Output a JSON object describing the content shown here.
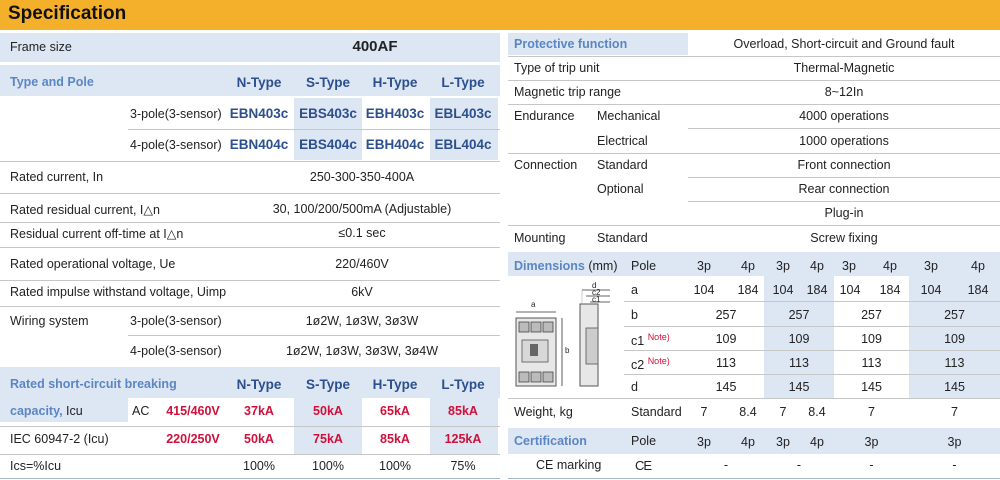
{
  "title": "Specification",
  "left": {
    "frame_size": {
      "label": "Frame size",
      "value": "400AF"
    },
    "type_pole": {
      "label": "Type and Pole",
      "types": [
        "N-Type",
        "S-Type",
        "H-Type",
        "L-Type"
      ],
      "rows": [
        {
          "pole": "3-pole(3-sensor)",
          "models": [
            "EBN403c",
            "EBS403c",
            "EBH403c",
            "EBL403c"
          ]
        },
        {
          "pole": "4-pole(3-sensor)",
          "models": [
            "EBN404c",
            "EBS404c",
            "EBH404c",
            "EBL404c"
          ]
        }
      ]
    },
    "rated_current": {
      "label": "Rated current, In",
      "value": "250-300-350-400A"
    },
    "residual_current": {
      "label": "Rated residual current, I△n",
      "value": "30, 100/200/500mA (Adjustable)"
    },
    "residual_offtime": {
      "label": "Residual current off-time at I△n",
      "value": "≤0.1 sec"
    },
    "operational_voltage": {
      "label": "Rated operational voltage, Ue",
      "value": "220/460V"
    },
    "impulse_voltage": {
      "label": "Rated impulse withstand voltage, Uimp",
      "value": "6kV"
    },
    "wiring": {
      "label": "Wiring system",
      "rows": [
        {
          "pole": "3-pole(3-sensor)",
          "value": "1ø2W, 1ø3W, 3ø3W"
        },
        {
          "pole": "4-pole(3-sensor)",
          "value": "1ø2W, 1ø3W, 3ø3W, 3ø4W"
        }
      ]
    },
    "breaking": {
      "label1": "Rated short-circuit breaking",
      "label2a": "capacity,",
      "label2b": " Icu",
      "types": [
        "N-Type",
        "S-Type",
        "H-Type",
        "L-Type"
      ],
      "ac_label": "AC",
      "rows": [
        {
          "label": "",
          "voltage": "415/460V",
          "values": [
            "37kA",
            "50kA",
            "65kA",
            "85kA"
          ]
        },
        {
          "label": "IEC 60947-2 (Icu)",
          "voltage": "220/250V",
          "values": [
            "50kA",
            "75kA",
            "85kA",
            "125kA"
          ]
        },
        {
          "label": "Ics=%Icu",
          "voltage": "",
          "values": [
            "100%",
            "100%",
            "100%",
            "75%"
          ]
        }
      ]
    }
  },
  "right": {
    "protective": {
      "label": "Protective function",
      "value": "Overload, Short-circuit and Ground fault"
    },
    "trip_unit": {
      "label": "Type of trip unit",
      "value": "Thermal-Magnetic"
    },
    "trip_range": {
      "label": "Magnetic trip range",
      "value": "8~12In"
    },
    "endurance": {
      "label": "Endurance",
      "rows": [
        {
          "sub": "Mechanical",
          "value": "4000 operations"
        },
        {
          "sub": "Electrical",
          "value": "1000 operations"
        }
      ]
    },
    "connection": {
      "label": "Connection",
      "rows": [
        {
          "sub": "Standard",
          "value": "Front connection"
        },
        {
          "sub": "Optional",
          "value": "Rear connection"
        },
        {
          "sub": "",
          "value": "Plug-in"
        }
      ]
    },
    "mounting": {
      "label": "Mounting",
      "sub": "Standard",
      "value": "Screw fixing"
    },
    "dimensions": {
      "label": "Dimensions",
      "unit": " (mm)",
      "pole_label": "Pole",
      "poles": [
        "3p",
        "4p",
        "3p",
        "4p",
        "3p",
        "4p",
        "3p",
        "4p"
      ],
      "rows": [
        {
          "key": "a",
          "note": "",
          "values": [
            "104",
            "184",
            "104",
            "184",
            "104",
            "184",
            "104",
            "184"
          ]
        },
        {
          "key": "b",
          "note": "",
          "values": [
            "257",
            "257",
            "257",
            "257"
          ]
        },
        {
          "key": "c1",
          "note": "Note)",
          "values": [
            "109",
            "109",
            "109",
            "109"
          ]
        },
        {
          "key": "c2",
          "note": "Note)",
          "values": [
            "113",
            "113",
            "113",
            "113"
          ]
        },
        {
          "key": "d",
          "note": "",
          "values": [
            "145",
            "145",
            "145",
            "145"
          ]
        }
      ],
      "diagram_labels": {
        "a": "a",
        "b": "b",
        "c1": "c1",
        "c2": "c2",
        "d": "d"
      }
    },
    "weight": {
      "label": "Weight, kg",
      "sub": "Standard",
      "values": [
        "7",
        "8.4",
        "7",
        "8.4",
        "7",
        "7"
      ]
    },
    "certification": {
      "label": "Certification",
      "pole_label": "Pole",
      "poles": [
        "3p",
        "4p",
        "3p",
        "4p",
        "3p",
        "3p"
      ],
      "ce_label": "CE marking",
      "ce_symbol": "CE",
      "values": [
        "-",
        "-",
        "-",
        "-"
      ]
    }
  }
}
